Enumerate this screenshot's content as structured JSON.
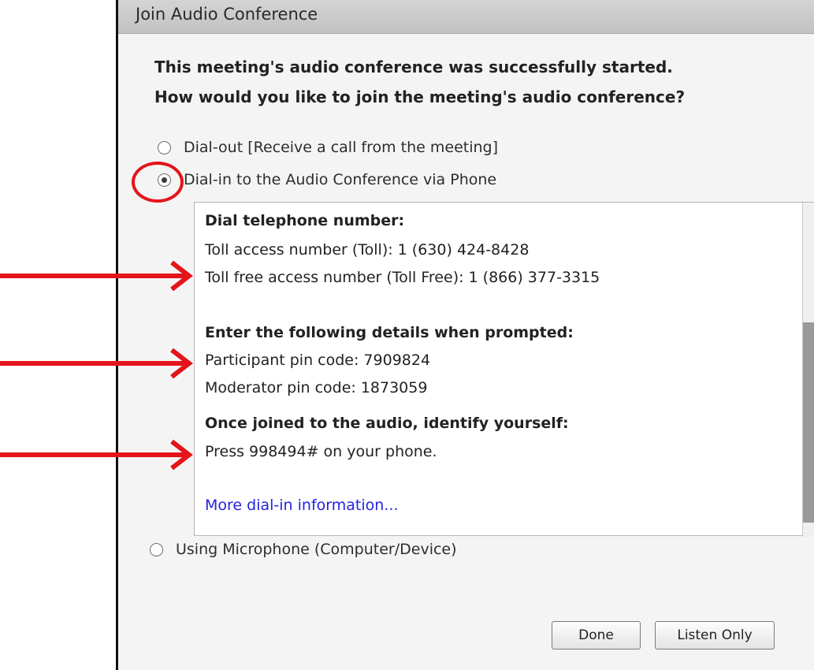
{
  "dialog": {
    "title": "Join Audio Conference",
    "prompt_line1": "This meeting's audio conference was successfully started.",
    "prompt_line2": "How would you like to join the meeting's audio conference?",
    "options": [
      {
        "label": "Dial-out [Receive a call from the meeting]",
        "selected": false
      },
      {
        "label": "Dial-in to the Audio Conference via Phone",
        "selected": true
      },
      {
        "label": "Using Microphone (Computer/Device)",
        "selected": false
      }
    ],
    "dial_info": {
      "heading_phone": "Dial telephone number:",
      "toll_number": "Toll access number (Toll): 1 (630) 424-8428",
      "toll_free_number": "Toll free access number (Toll Free): 1 (866) 377-3315",
      "heading_details": "Enter the following details when prompted:",
      "participant_pin": "Participant pin code: 7909824",
      "moderator_pin": "Moderator pin code: 1873059",
      "heading_identify": "Once joined to the audio, identify yourself:",
      "press_code": "Press 998494# on your phone.",
      "more_link": "More dial-in information..."
    },
    "side_glyph": "≡",
    "buttons": {
      "done": "Done",
      "listen_only": "Listen Only"
    }
  },
  "annotation_color": "#e4141b"
}
